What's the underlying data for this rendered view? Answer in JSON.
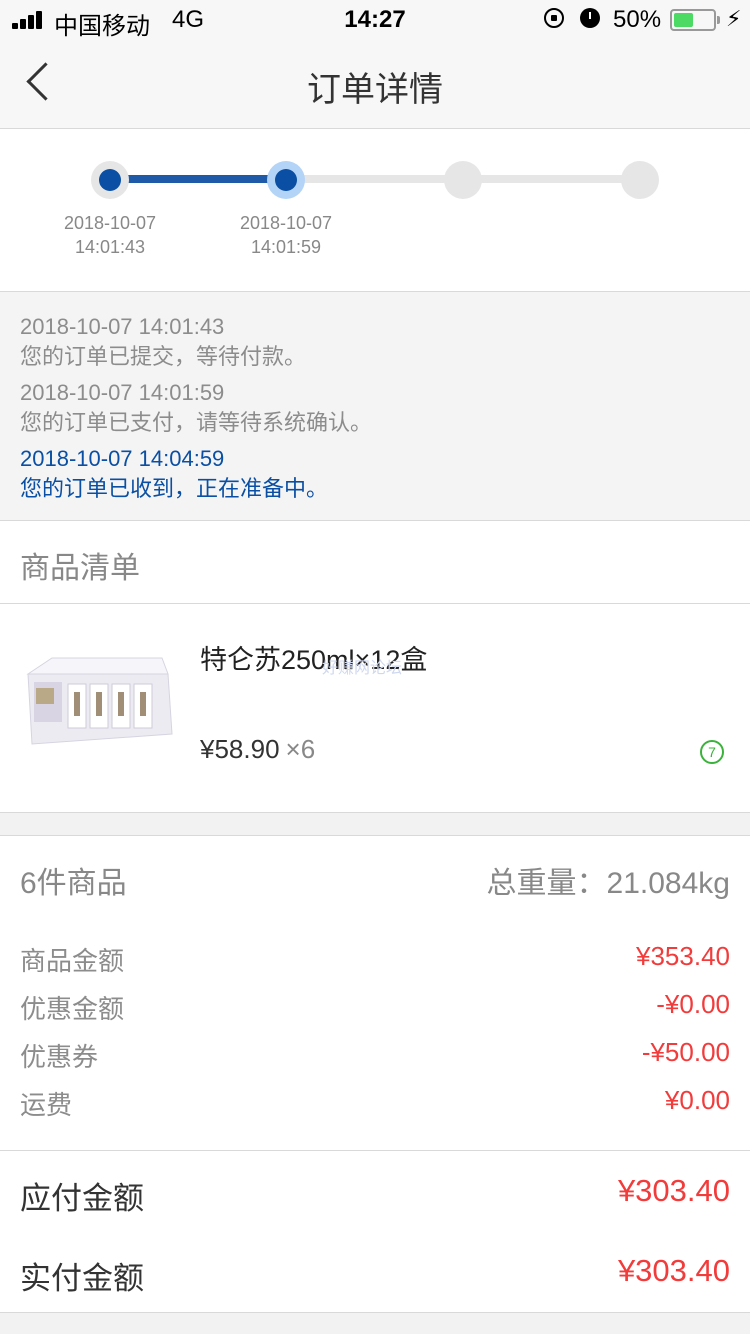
{
  "status_bar": {
    "carrier": "中国移动",
    "network": "4G",
    "time": "14:27",
    "battery": "50%",
    "battery_level": 0.5,
    "icons": [
      "signal-icon",
      "rotation-lock-icon",
      "alarm-icon",
      "battery-icon",
      "charging-icon"
    ]
  },
  "nav": {
    "title": "订单详情",
    "back_icon": "chevron-left-icon"
  },
  "progress": {
    "steps": [
      {
        "state": "done",
        "date": "2018-10-07",
        "time": "14:01:43"
      },
      {
        "state": "current",
        "date": "2018-10-07",
        "time": "14:01:59"
      },
      {
        "state": "pending",
        "date": "",
        "time": ""
      },
      {
        "state": "pending",
        "date": "",
        "time": ""
      }
    ],
    "colors": {
      "done": "#0a4fa3",
      "pending": "#e6e6e6",
      "current_ring": "#b3d4f7"
    }
  },
  "log": [
    {
      "timestamp": "2018-10-07 14:01:43",
      "message": "您的订单已提交，等待付款。"
    },
    {
      "timestamp": "2018-10-07 14:01:59",
      "message": "您的订单已支付，请等待系统确认。"
    },
    {
      "timestamp": "2018-10-07 14:04:59",
      "message": "您的订单已收到，正在准备中。"
    }
  ],
  "products_section": {
    "title": "商品清单"
  },
  "product": {
    "name": "特仑苏250ml×12盒",
    "price": "¥58.90",
    "quantity": "×6",
    "badge": "7",
    "watermark": "好赚网论坛"
  },
  "summary": {
    "count": "6件商品",
    "weight": "总重量：21.084kg"
  },
  "fees": [
    {
      "label": "商品金额",
      "value": "¥353.40"
    },
    {
      "label": "优惠金额",
      "value": "-¥0.00"
    },
    {
      "label": "优惠券",
      "value": "-¥50.00"
    },
    {
      "label": "运费",
      "value": "¥0.00"
    }
  ],
  "totals": [
    {
      "label": "应付金额",
      "value": "¥303.40"
    },
    {
      "label": "实付金额",
      "value": "¥303.40"
    }
  ],
  "accent_color": "#f23b3b"
}
